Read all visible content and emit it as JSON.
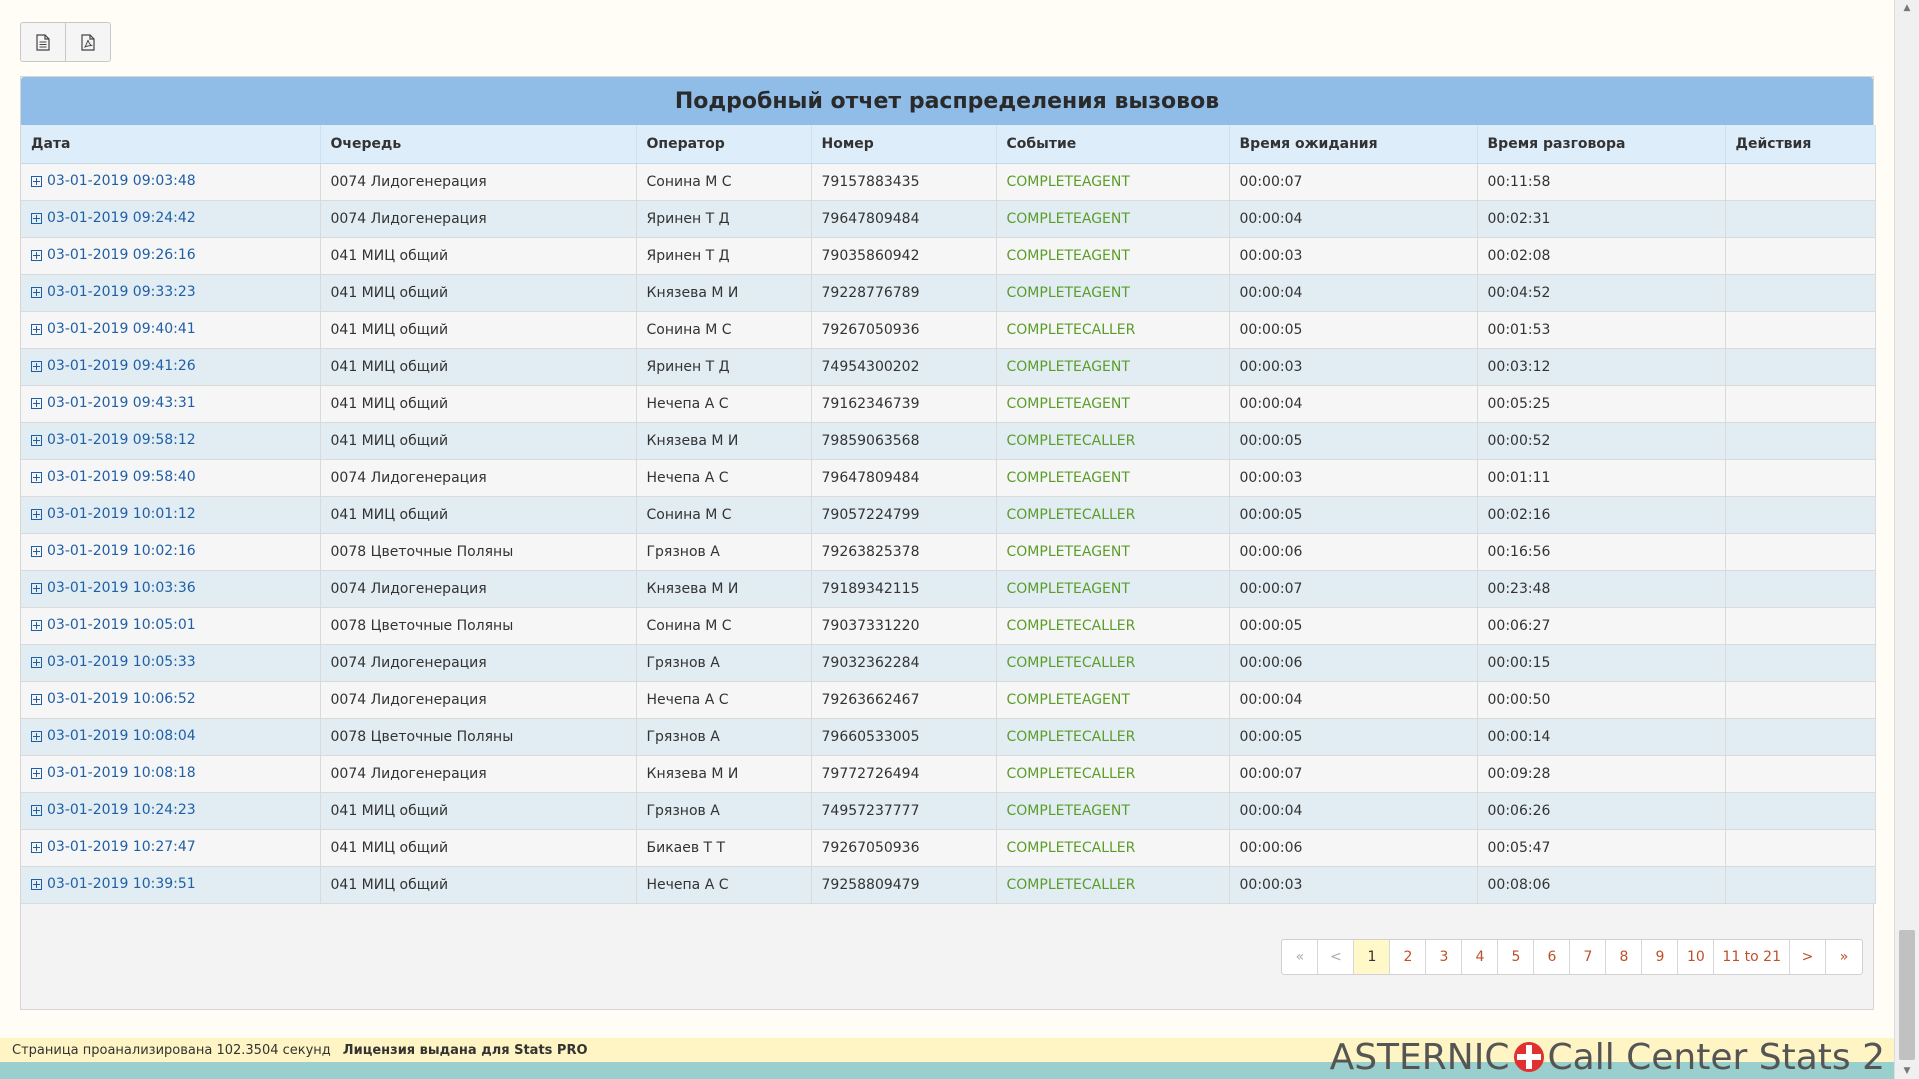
{
  "title": "Подробный отчет распределения вызовов",
  "toolbar": {
    "icons": [
      "document-icon",
      "pdf-icon"
    ]
  },
  "columns": [
    "Дата",
    "Очередь",
    "Оператор",
    "Номер",
    "Событие",
    "Время ожидания",
    "Время разговора",
    "Действия"
  ],
  "rows": [
    {
      "date": "03-01-2019 09:03:48",
      "queue": "0074 Лидогенерация",
      "agent": "Сонина М С",
      "number": "79157883435",
      "event": "COMPLETEAGENT",
      "wait": "00:00:07",
      "talk": "00:11:58"
    },
    {
      "date": "03-01-2019 09:24:42",
      "queue": "0074 Лидогенерация",
      "agent": "Яринен Т Д",
      "number": "79647809484",
      "event": "COMPLETEAGENT",
      "wait": "00:00:04",
      "talk": "00:02:31"
    },
    {
      "date": "03-01-2019 09:26:16",
      "queue": "041 МИЦ общий",
      "agent": "Яринен Т Д",
      "number": "79035860942",
      "event": "COMPLETEAGENT",
      "wait": "00:00:03",
      "talk": "00:02:08"
    },
    {
      "date": "03-01-2019 09:33:23",
      "queue": "041 МИЦ общий",
      "agent": "Князева М И",
      "number": "79228776789",
      "event": "COMPLETEAGENT",
      "wait": "00:00:04",
      "talk": "00:04:52"
    },
    {
      "date": "03-01-2019 09:40:41",
      "queue": "041 МИЦ общий",
      "agent": "Сонина М С",
      "number": "79267050936",
      "event": "COMPLETECALLER",
      "wait": "00:00:05",
      "talk": "00:01:53"
    },
    {
      "date": "03-01-2019 09:41:26",
      "queue": "041 МИЦ общий",
      "agent": "Яринен Т Д",
      "number": "74954300202",
      "event": "COMPLETEAGENT",
      "wait": "00:00:03",
      "talk": "00:03:12"
    },
    {
      "date": "03-01-2019 09:43:31",
      "queue": "041 МИЦ общий",
      "agent": "Нечепа А С",
      "number": "79162346739",
      "event": "COMPLETEAGENT",
      "wait": "00:00:04",
      "talk": "00:05:25"
    },
    {
      "date": "03-01-2019 09:58:12",
      "queue": "041 МИЦ общий",
      "agent": "Князева М И",
      "number": "79859063568",
      "event": "COMPLETECALLER",
      "wait": "00:00:05",
      "talk": "00:00:52"
    },
    {
      "date": "03-01-2019 09:58:40",
      "queue": "0074 Лидогенерация",
      "agent": "Нечепа А С",
      "number": "79647809484",
      "event": "COMPLETEAGENT",
      "wait": "00:00:03",
      "talk": "00:01:11"
    },
    {
      "date": "03-01-2019 10:01:12",
      "queue": "041 МИЦ общий",
      "agent": "Сонина М С",
      "number": "79057224799",
      "event": "COMPLETECALLER",
      "wait": "00:00:05",
      "talk": "00:02:16"
    },
    {
      "date": "03-01-2019 10:02:16",
      "queue": "0078 Цветочные Поляны",
      "agent": "Грязнов А",
      "number": "79263825378",
      "event": "COMPLETEAGENT",
      "wait": "00:00:06",
      "talk": "00:16:56"
    },
    {
      "date": "03-01-2019 10:03:36",
      "queue": "0074 Лидогенерация",
      "agent": "Князева М И",
      "number": "79189342115",
      "event": "COMPLETEAGENT",
      "wait": "00:00:07",
      "talk": "00:23:48"
    },
    {
      "date": "03-01-2019 10:05:01",
      "queue": "0078 Цветочные Поляны",
      "agent": "Сонина М С",
      "number": "79037331220",
      "event": "COMPLETECALLER",
      "wait": "00:00:05",
      "talk": "00:06:27"
    },
    {
      "date": "03-01-2019 10:05:33",
      "queue": "0074 Лидогенерация",
      "agent": "Грязнов А",
      "number": "79032362284",
      "event": "COMPLETECALLER",
      "wait": "00:00:06",
      "talk": "00:00:15"
    },
    {
      "date": "03-01-2019 10:06:52",
      "queue": "0074 Лидогенерация",
      "agent": "Нечепа А С",
      "number": "79263662467",
      "event": "COMPLETEAGENT",
      "wait": "00:00:04",
      "talk": "00:00:50"
    },
    {
      "date": "03-01-2019 10:08:04",
      "queue": "0078 Цветочные Поляны",
      "agent": "Грязнов А",
      "number": "79660533005",
      "event": "COMPLETECALLER",
      "wait": "00:00:05",
      "talk": "00:00:14"
    },
    {
      "date": "03-01-2019 10:08:18",
      "queue": "0074 Лидогенерация",
      "agent": "Князева М И",
      "number": "79772726494",
      "event": "COMPLETECALLER",
      "wait": "00:00:07",
      "talk": "00:09:28"
    },
    {
      "date": "03-01-2019 10:24:23",
      "queue": "041 МИЦ общий",
      "agent": "Грязнов А",
      "number": "74957237777",
      "event": "COMPLETEAGENT",
      "wait": "00:00:04",
      "talk": "00:06:26"
    },
    {
      "date": "03-01-2019 10:27:47",
      "queue": "041 МИЦ общий",
      "agent": "Бикаев Т Т",
      "number": "79267050936",
      "event": "COMPLETECALLER",
      "wait": "00:00:06",
      "talk": "00:05:47"
    },
    {
      "date": "03-01-2019 10:39:51",
      "queue": "041 МИЦ общий",
      "agent": "Нечепа А С",
      "number": "79258809479",
      "event": "COMPLETECALLER",
      "wait": "00:00:03",
      "talk": "00:08:06"
    }
  ],
  "pagination": {
    "items": [
      "«",
      "<",
      "1",
      "2",
      "3",
      "4",
      "5",
      "6",
      "7",
      "8",
      "9",
      "10",
      "11 to 21",
      ">",
      "»"
    ],
    "active": "1",
    "disabled": [
      "«",
      "<"
    ]
  },
  "footer": {
    "analyzed": "Страница проанализирована 102.3504 секунд",
    "license": "Лицензия выдана для Stats PRO"
  },
  "brand": {
    "left": "ASTERNIC",
    "right": "Call Center Stats 2"
  },
  "colors": {
    "header": "#8fbde7",
    "event": "#5b9d2a",
    "link": "#1f5fa6",
    "pager": "#c0502a",
    "footer": "#fff5c4",
    "bottom_bar": "#99cfcd"
  }
}
